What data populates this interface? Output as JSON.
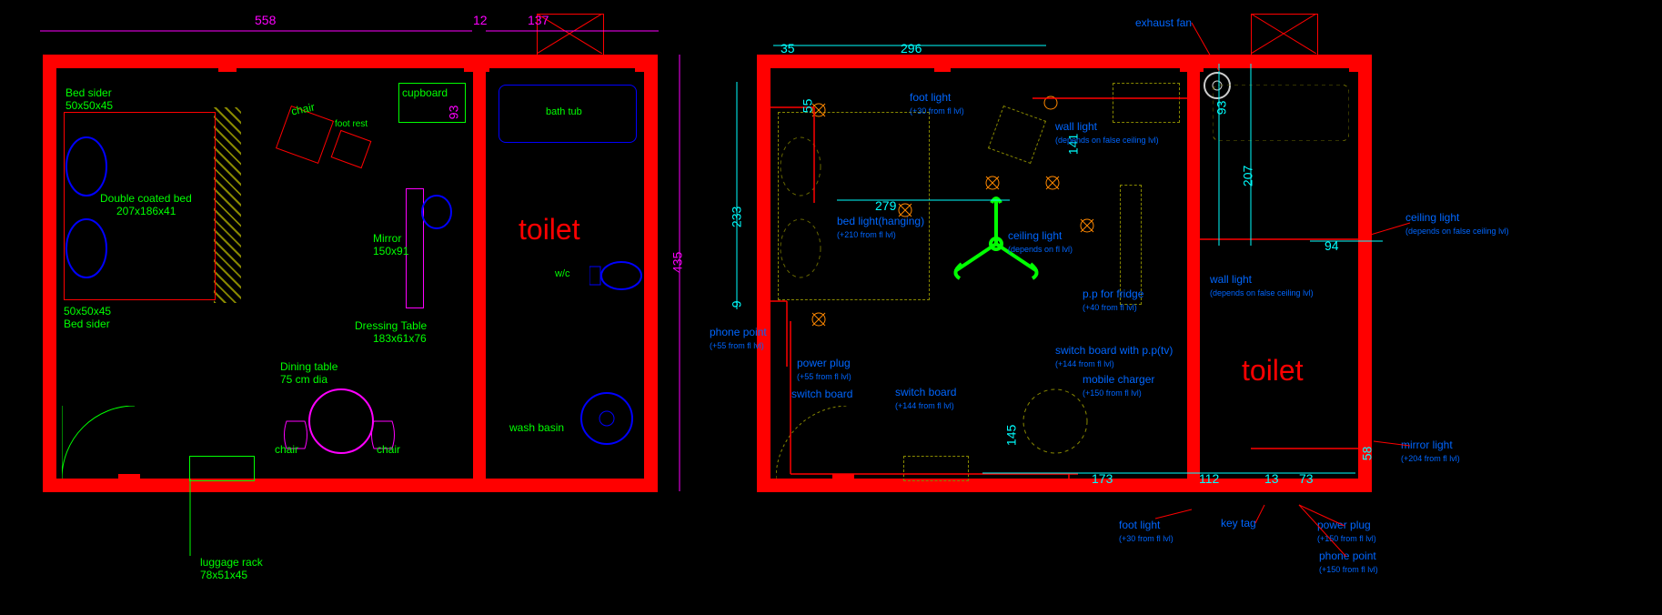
{
  "left": {
    "dims": {
      "w558": "558",
      "w12": "12",
      "w137": "137",
      "h93": "93",
      "h435": "435"
    },
    "items": {
      "bedsider_t": "Bed sider",
      "bedsider_dim": "50x50x45",
      "bedsider_b": "50x50x45",
      "bedsider_b2": "Bed sider",
      "bed": "Double coated bed",
      "bed_dim": "207x186x41",
      "chair": "chair",
      "footrest": "foot rest",
      "cupboard": "cupboard",
      "mirror": "Mirror",
      "mirror_dim": "150x91",
      "dressing": "Dressing Table",
      "dressing_dim": "183x61x76",
      "dining": "Dining table",
      "dining_dim": "75 cm dia",
      "chair2": "chair",
      "chair3": "chair",
      "luggage": "luggage rack",
      "luggage_dim": "78x51x45",
      "bathtub": "bath tub",
      "wc": "w/c",
      "wash": "wash basin",
      "toilet": "toilet"
    }
  },
  "right": {
    "dims": {
      "d35": "35",
      "d296": "296",
      "d55": "55",
      "d233": "233",
      "d9": "9",
      "d279": "279",
      "d93": "93",
      "d207": "207",
      "d94": "94",
      "d112": "112",
      "d13": "13",
      "d73": "73",
      "d141": "141",
      "d173": "173",
      "d58": "58",
      "d145": "145"
    },
    "items": {
      "exhaust": "exhaust fan",
      "footlight": "foot light",
      "footlight_sub": "(+30 from fl lvl)",
      "walllight": "wall light",
      "walllight_sub": "(depends on false ceiling lvl)",
      "bedlight": "bed light(hanging)",
      "bedlight_sub": "(+210 from fl lvl)",
      "ceilinglight": "ceiling light",
      "ceilinglight_sub": "(depends on fl lvl)",
      "phonepoint": "phone point",
      "phonepoint_sub": "(+55 from fl lvl)",
      "powerplug": "power plug",
      "powerplug_sub": "(+55 from fl lvl)",
      "switchboard": "switch board",
      "switchboard2": "switch board",
      "switchboard2_sub": "(+144 from fl lvl)",
      "switchboard3": "switch board with p.p(tv)",
      "switchboard3_sub": "(+144 from fl lvl)",
      "pp_fridge": "p.p for fridge",
      "pp_fridge_sub": "(+40 from fl lvl)",
      "walllight2": "wall light",
      "walllight2_sub": "(depends on false ceiling lvl)",
      "mobile": "mobile charger",
      "mobile_sub": "(+150 from fl lvl)",
      "footlight2": "foot light",
      "footlight2_sub": "(+30 from fl lvl)",
      "keytag": "key tag",
      "powerplug2": "power plug",
      "powerplug2_sub": "(+150 from fl lvl)",
      "phonepoint2": "phone point",
      "phonepoint2_sub": "(+150 from fl lvl)",
      "mirrorlight": "mirror light",
      "mirrorlight_sub": "(+204 from fl lvl)",
      "toilet": "toilet"
    }
  }
}
